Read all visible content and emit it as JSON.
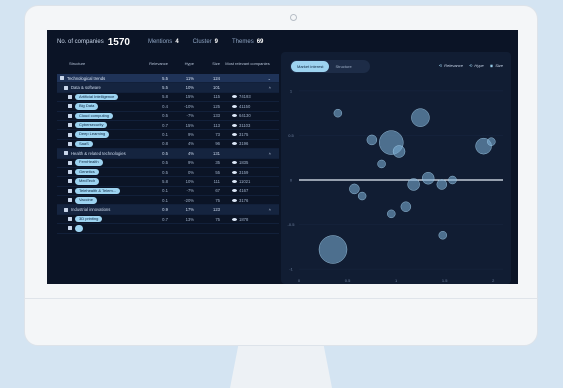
{
  "topbar": {
    "companies_label": "No. of companies",
    "companies_value": "1570",
    "meta": [
      {
        "label": "Mentions",
        "value": "4"
      },
      {
        "label": "Cluster",
        "value": "9"
      },
      {
        "label": "Themes",
        "value": "69"
      }
    ]
  },
  "table": {
    "headers": [
      "Structure",
      "Relevance",
      "Hype",
      "Size",
      "Most relevant companies"
    ],
    "rows": [
      {
        "kind": "cat",
        "name": "Technological trends",
        "v1": "5.5",
        "v2": "11%",
        "v3": "124",
        "mk": ""
      },
      {
        "kind": "sub",
        "name": "Data & software",
        "v1": "5.5",
        "v2": "10%",
        "v3": "101",
        "mk": ""
      },
      {
        "kind": "item",
        "name": "Artificial Intelligence",
        "v1": "5.8",
        "v2": "15%",
        "v3": "115",
        "mk": "74193"
      },
      {
        "kind": "item",
        "name": "Big Data",
        "v1": "0.4",
        "v2": "-10%",
        "v3": "125",
        "mk": "41150"
      },
      {
        "kind": "item",
        "name": "Cloud computing",
        "v1": "0.5",
        "v2": "-7%",
        "v3": "133",
        "mk": "64130"
      },
      {
        "kind": "item",
        "name": "Cybersecurity",
        "v1": "0.7",
        "v2": "15%",
        "v3": "113",
        "mk": "31103"
      },
      {
        "kind": "item",
        "name": "Deep Learning",
        "v1": "0.1",
        "v2": "9%",
        "v3": "73",
        "mk": "3175"
      },
      {
        "kind": "item",
        "name": "SaaS",
        "v1": "0.8",
        "v2": "4%",
        "v3": "96",
        "mk": "3196"
      },
      {
        "kind": "sub",
        "name": "Health & related technologies",
        "v1": "0.5",
        "v2": "4%",
        "v3": "131",
        "mk": ""
      },
      {
        "kind": "item",
        "name": "FemHealth",
        "v1": "0.5",
        "v2": "9%",
        "v3": "35",
        "mk": "1835"
      },
      {
        "kind": "item",
        "name": "Genetics",
        "v1": "0.5",
        "v2": "0%",
        "v3": "55",
        "mk": "3159"
      },
      {
        "kind": "item",
        "name": "MedTech",
        "v1": "5.8",
        "v2": "10%",
        "v3": "111",
        "mk": "11021"
      },
      {
        "kind": "item",
        "name": "Telehealth & Telem...",
        "v1": "0.1",
        "v2": "-7%",
        "v3": "67",
        "mk": "4167"
      },
      {
        "kind": "item",
        "name": "Vaccine",
        "v1": "0.1",
        "v2": "-20%",
        "v3": "75",
        "mk": "3176"
      },
      {
        "kind": "sub",
        "name": "Industrial innovations",
        "v1": "0.9",
        "v2": "17%",
        "v3": "123",
        "mk": ""
      },
      {
        "kind": "item",
        "name": "3D printing",
        "v1": "0.7",
        "v2": "13%",
        "v3": "75",
        "mk": "1878"
      },
      {
        "kind": "item",
        "name": "",
        "v1": "",
        "v2": "",
        "v3": "",
        "mk": ""
      }
    ]
  },
  "panel": {
    "toggle_active": "Market interest",
    "toggle_inactive": "Structure",
    "legend": [
      "Relevance",
      "Hype",
      "Size"
    ],
    "y_ticks": [
      "1",
      "0.5",
      "0",
      "-0.5",
      "-1"
    ],
    "x_ticks": [
      "0",
      "0.5",
      "1",
      "1.5",
      "2"
    ]
  },
  "chart_data": {
    "type": "scatter",
    "title": "",
    "xlabel": "",
    "ylabel": "",
    "xlim": [
      0,
      2.1
    ],
    "ylim": [
      -1.1,
      1.1
    ],
    "points": [
      {
        "x": 0.4,
        "y": 0.75,
        "s": 4
      },
      {
        "x": 0.75,
        "y": 0.45,
        "s": 5
      },
      {
        "x": 0.95,
        "y": 0.42,
        "s": 12
      },
      {
        "x": 1.25,
        "y": 0.7,
        "s": 9
      },
      {
        "x": 0.85,
        "y": 0.18,
        "s": 4
      },
      {
        "x": 1.03,
        "y": 0.32,
        "s": 6
      },
      {
        "x": 1.9,
        "y": 0.38,
        "s": 8
      },
      {
        "x": 1.98,
        "y": 0.43,
        "s": 4
      },
      {
        "x": 0.57,
        "y": -0.1,
        "s": 5
      },
      {
        "x": 1.18,
        "y": -0.05,
        "s": 6
      },
      {
        "x": 1.33,
        "y": 0.02,
        "s": 6
      },
      {
        "x": 1.47,
        "y": -0.05,
        "s": 5
      },
      {
        "x": 1.1,
        "y": -0.3,
        "s": 5
      },
      {
        "x": 0.95,
        "y": -0.38,
        "s": 4
      },
      {
        "x": 1.48,
        "y": -0.62,
        "s": 4
      },
      {
        "x": 0.35,
        "y": -0.78,
        "s": 14
      },
      {
        "x": 0.65,
        "y": -0.18,
        "s": 4
      },
      {
        "x": 1.58,
        "y": 0.0,
        "s": 4
      }
    ]
  }
}
